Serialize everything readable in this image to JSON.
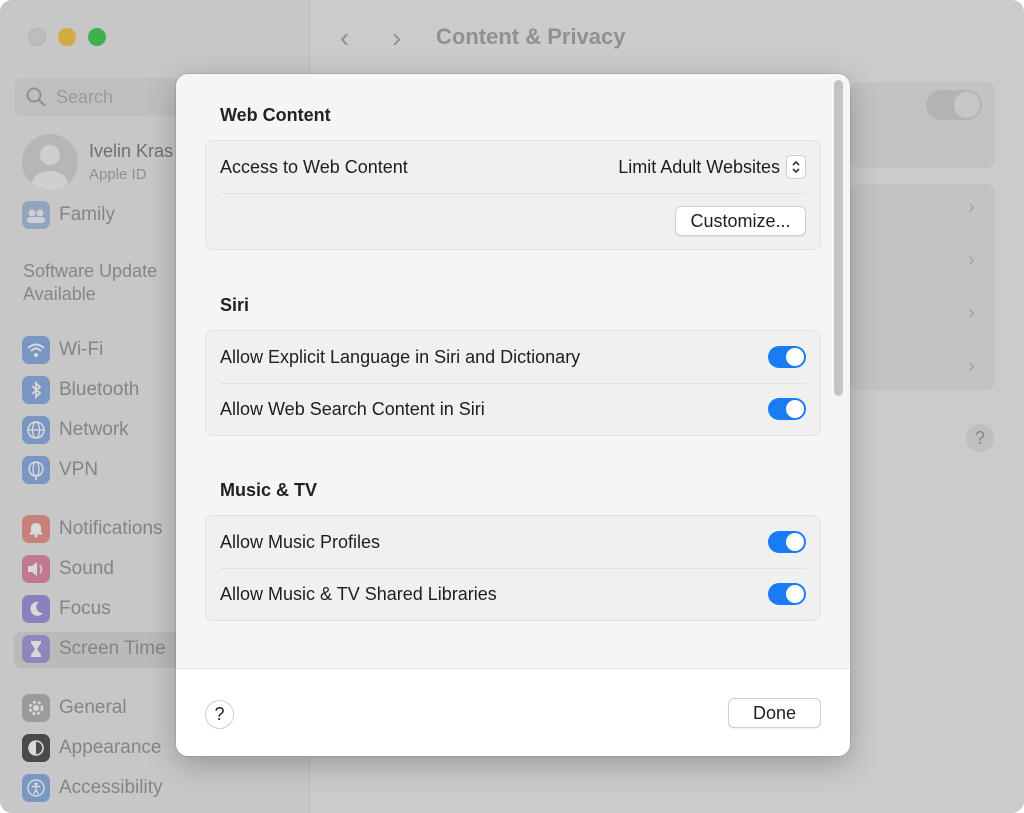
{
  "window": {
    "title": "Content & Privacy"
  },
  "sidebar": {
    "search_placeholder": "Search",
    "profile": {
      "name": "Ivelin Kras",
      "subtitle": "Apple ID"
    },
    "family_label": "Family",
    "software_update": "Software Update Available",
    "items": [
      {
        "label": "Wi-Fi",
        "icon": "wifi-icon",
        "color": "#7aa4e0"
      },
      {
        "label": "Bluetooth",
        "icon": "bluetooth-icon",
        "color": "#7aa4e0"
      },
      {
        "label": "Network",
        "icon": "globe-icon",
        "color": "#7aa4e0"
      },
      {
        "label": "VPN",
        "icon": "vpn-globe-icon",
        "color": "#7aa4e0"
      },
      {
        "label": "Notifications",
        "icon": "bell-icon",
        "color": "#e8847c"
      },
      {
        "label": "Sound",
        "icon": "speaker-icon",
        "color": "#e07a9a"
      },
      {
        "label": "Focus",
        "icon": "moon-icon",
        "color": "#8f86d6"
      },
      {
        "label": "Screen Time",
        "icon": "hourglass-icon",
        "color": "#9a8cd8",
        "selected": true
      },
      {
        "label": "General",
        "icon": "gear-icon",
        "color": "#a9a9a9"
      },
      {
        "label": "Appearance",
        "icon": "appearance-icon",
        "color": "#3a3a3a"
      },
      {
        "label": "Accessibility",
        "icon": "accessibility-icon",
        "color": "#7aa4e0"
      }
    ]
  },
  "sheet": {
    "web_content": {
      "title": "Web Content",
      "access_label": "Access to Web Content",
      "access_value": "Limit Adult Websites",
      "customize_label": "Customize..."
    },
    "siri": {
      "title": "Siri",
      "rows": [
        {
          "label": "Allow Explicit Language in Siri and Dictionary",
          "on": true
        },
        {
          "label": "Allow Web Search Content in Siri",
          "on": true
        }
      ]
    },
    "music_tv": {
      "title": "Music & TV",
      "rows": [
        {
          "label": "Allow Music Profiles",
          "on": true
        },
        {
          "label": "Allow Music & TV Shared Libraries",
          "on": true
        }
      ]
    },
    "footer": {
      "help_label": "?",
      "done_label": "Done"
    }
  },
  "background": {
    "help_label": "?"
  },
  "colors": {
    "accent": "#1a7cf2",
    "traffic_close": "#d9d9d9",
    "traffic_minimize": "#f5bf2f",
    "traffic_maximize": "#28c840"
  }
}
